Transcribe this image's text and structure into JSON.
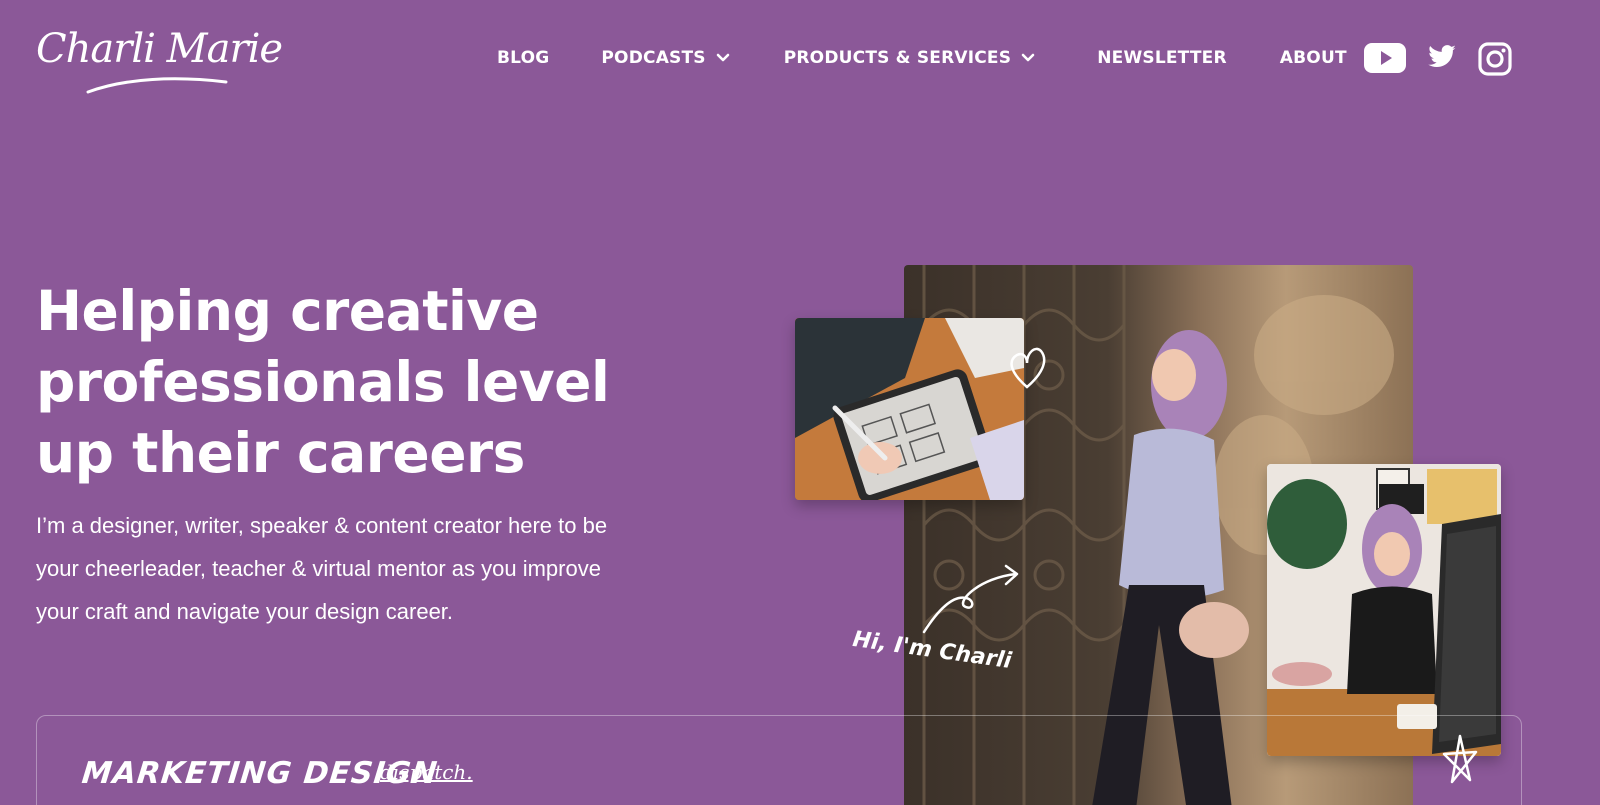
{
  "header": {
    "logo_text": "Charli Marie",
    "nav": [
      {
        "label": "BLOG",
        "has_dropdown": false
      },
      {
        "label": "PODCASTS",
        "has_dropdown": true
      },
      {
        "label": "PRODUCTS & SERVICES",
        "has_dropdown": true
      },
      {
        "label": "NEWSLETTER",
        "has_dropdown": false
      },
      {
        "label": "ABOUT",
        "has_dropdown": false
      }
    ],
    "social_icons": [
      "youtube-icon",
      "twitter-icon",
      "instagram-icon"
    ]
  },
  "hero": {
    "title": "Helping creative professionals level up their careers",
    "description": "I’m a designer, writer, speaker & content creator here to be your cheerleader, teacher & virtual mentor as you improve your craft and navigate your design career.",
    "photo_caption": "Hi, I'm Charli"
  },
  "dispatch": {
    "title": "MARKETING DESIGN",
    "subtitle": "dispatch."
  },
  "colors": {
    "background": "#8b5898",
    "text": "#ffffff"
  }
}
